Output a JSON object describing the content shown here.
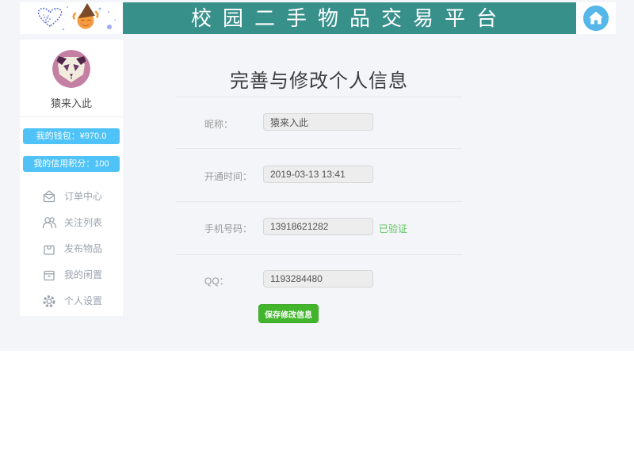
{
  "header": {
    "title": "校园二手物品交易平台",
    "home_icon": "home-icon"
  },
  "sidebar": {
    "username": "猿来入此",
    "wallet_label": "我的钱包：¥970.0",
    "credit_label": "我的信用积分：100",
    "menu": [
      {
        "icon": "order-envelope-icon",
        "label": "订单中心"
      },
      {
        "icon": "follow-people-icon",
        "label": "关注列表"
      },
      {
        "icon": "publish-bag-icon",
        "label": "发布物品"
      },
      {
        "icon": "idle-box-icon",
        "label": "我的闲置"
      },
      {
        "icon": "settings-gear-icon",
        "label": "个人设置"
      }
    ]
  },
  "main": {
    "title": "完善与修改个人信息",
    "fields": [
      {
        "label": "昵称：",
        "value": "猿来入此"
      },
      {
        "label": "开通时间：",
        "value": "2019-03-13 13:41"
      },
      {
        "label": "手机号码：",
        "value": "13918621282",
        "badge": "已验证"
      },
      {
        "label": "QQ：",
        "value": "1193284480"
      }
    ],
    "save_label": "保存修改信息"
  },
  "colors": {
    "header_teal": "#38908b",
    "sidebar_button_blue": "#4fc3f7",
    "home_circle_blue": "#55b7e8",
    "verified_green": "#62c462",
    "save_green": "#42b52d",
    "page_bg": "#f3f5f8"
  }
}
